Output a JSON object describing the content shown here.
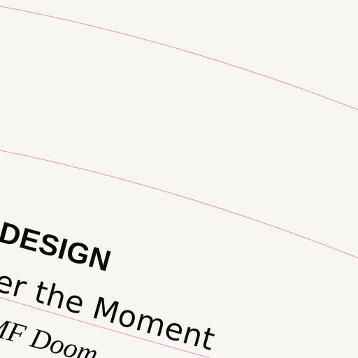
{
  "poster": {
    "heading": "DESIGN",
    "subtitle": "er the Moment",
    "author": "MF Doom"
  },
  "colors": {
    "background": "#f8f6f0",
    "text": "#0b0b0b",
    "guide_line": "#e58fc0"
  }
}
